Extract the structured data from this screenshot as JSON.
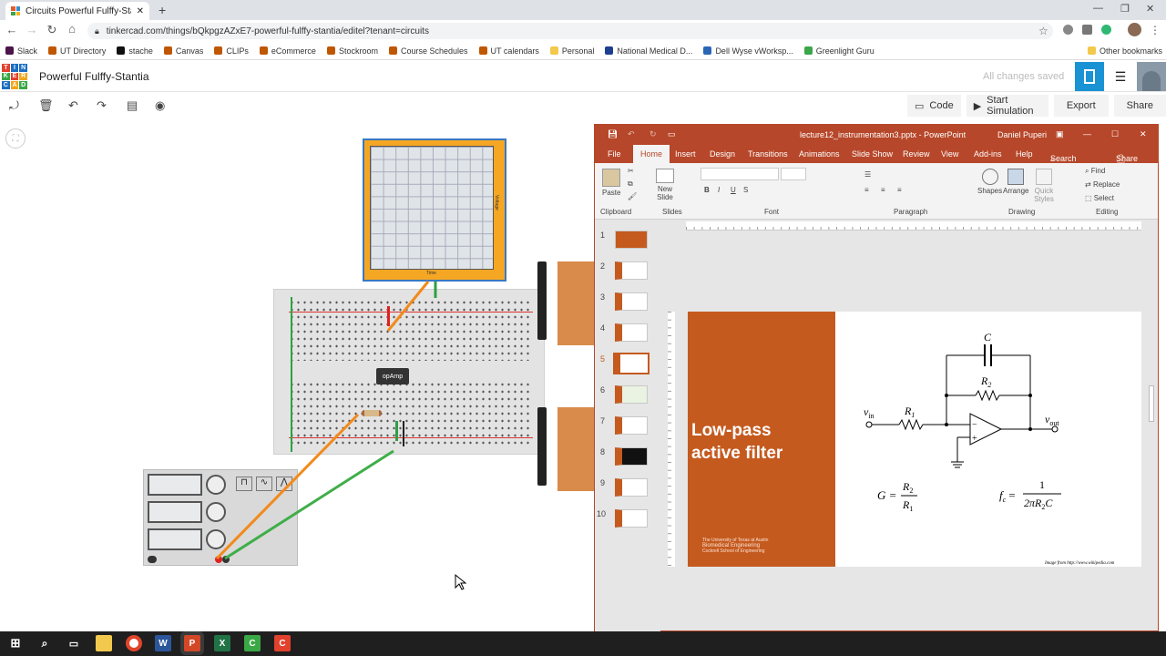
{
  "browser": {
    "tab_title": "Circuits Powerful Fulffy-Stantia | Tin",
    "url": "tinkercad.com/things/bQkpgzAZxE7-powerful-fulffy-stantia/editel?tenant=circuits",
    "bookmarks": [
      "Slack",
      "UT Directory",
      "stache",
      "Canvas",
      "CLIPs",
      "eCommerce",
      "Stockroom",
      "Course Schedules",
      "UT calendars",
      "Personal",
      "National Medical D...",
      "Dell Wyse vWorksp...",
      "Greenlight Guru"
    ],
    "other_bookmarks": "Other bookmarks"
  },
  "tinkercad": {
    "logo_letters": [
      "T",
      "I",
      "N",
      "K",
      "E",
      "R",
      "C",
      "A",
      "D"
    ],
    "project_title": "Powerful Fulffy-Stantia",
    "save_status": "All changes saved",
    "actions": {
      "code": "Code",
      "simulate": "Start Simulation",
      "export": "Export",
      "share": "Share"
    },
    "oscilloscope": {
      "y_label": "Voltage",
      "x_label": "Time"
    },
    "opamp_label": "opAmp"
  },
  "powerpoint": {
    "title": "lecture12_instrumentation3.pptx  -  PowerPoint",
    "user": "Daniel Puperi",
    "tabs": [
      "File",
      "Home",
      "Insert",
      "Design",
      "Transitions",
      "Animations",
      "Slide Show",
      "Review",
      "View",
      "Add-ins",
      "Help",
      "Search",
      "Share"
    ],
    "active_tab": "Home",
    "groups": [
      "Clipboard",
      "Slides",
      "Font",
      "Paragraph",
      "Drawing",
      "Editing"
    ],
    "clipboard": {
      "paste": "Paste"
    },
    "slides": {
      "new_slide": "New Slide"
    },
    "drawing": {
      "shapes": "Shapes",
      "arrange": "Arrange",
      "quick_styles": "Quick Styles"
    },
    "editing": {
      "find": "Find",
      "replace": "Replace",
      "select": "Select"
    },
    "slide_numbers": [
      "1",
      "2",
      "3",
      "4",
      "5",
      "6",
      "7",
      "8",
      "9",
      "10"
    ],
    "active_slide": "5",
    "slide": {
      "title_line1": "Low-pass",
      "title_line2": "active filter",
      "logo_line1": "The University of Texas at Austin",
      "logo_line2": "Biomedical Engineering",
      "logo_line3": "Cockrell School of Engineering",
      "credit": "Image from http://www.wikipedia.com",
      "cap": "C",
      "r2": "R",
      "r2_sub": "2",
      "r1": "R",
      "r1_sub": "1",
      "vin": "v",
      "vin_sub": "in",
      "vout": "v",
      "vout_sub": "out",
      "gain_lhs": "G =",
      "gain_num": "R",
      "gain_num_sub": "2",
      "gain_den": "R",
      "gain_den_sub": "1",
      "fc_lhs": "f",
      "fc_lhs_sub": "c",
      "fc_eq": "=",
      "fc_num": "1",
      "fc_den": "2πR",
      "fc_den_sub": "2",
      "fc_den_tail": "C"
    }
  }
}
